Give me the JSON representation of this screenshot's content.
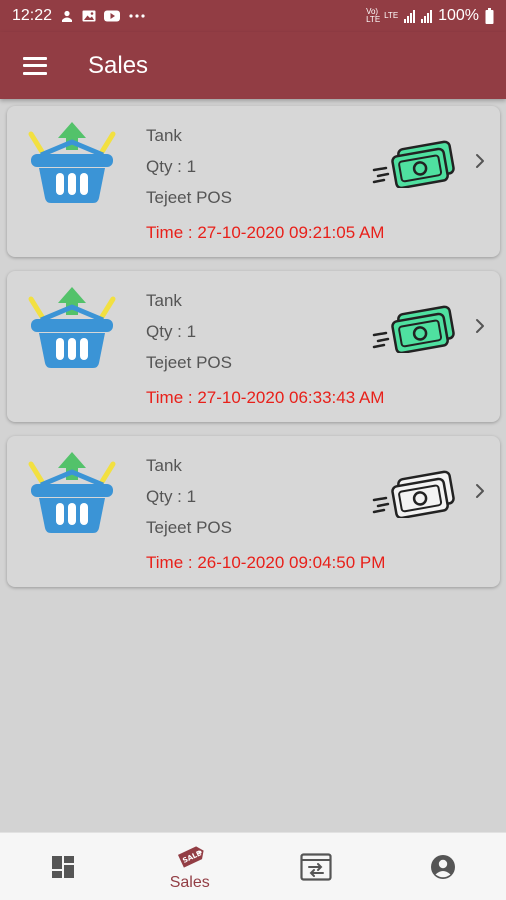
{
  "status_bar": {
    "time": "12:22",
    "battery": "100%",
    "icons": [
      "person-icon",
      "image-icon",
      "youtube-icon",
      "more-icon",
      "volte-icon",
      "lte-icon",
      "signal-icon",
      "battery-icon"
    ],
    "labels": {
      "volte": "Vo) LTE",
      "lte": "LTE"
    }
  },
  "app_bar": {
    "title": "Sales",
    "menu_icon": "hamburger-menu-icon"
  },
  "sales": [
    {
      "product": "Tank",
      "qty": "Qty : 1",
      "store": "Tejeet POS",
      "time": "Time : 27-10-2020 09:21:05 AM",
      "cash_color": "#4fe0a0",
      "paid": true
    },
    {
      "product": "Tank",
      "qty": "Qty : 1",
      "store": "Tejeet POS",
      "time": "Time : 27-10-2020 06:33:43 AM",
      "cash_color": "#4fe0a0",
      "paid": true
    },
    {
      "product": "Tank",
      "qty": "Qty : 1",
      "store": "Tejeet POS",
      "time": "Time : 26-10-2020 09:04:50 PM",
      "cash_color": "#f3f3f3",
      "paid": false
    }
  ],
  "bottom_nav": {
    "items": [
      {
        "icon": "dashboard-icon",
        "label": ""
      },
      {
        "icon": "sale-tag-icon",
        "label": "Sales",
        "active": true
      },
      {
        "icon": "transfer-icon",
        "label": ""
      },
      {
        "icon": "account-icon",
        "label": ""
      }
    ]
  },
  "colors": {
    "primary": "#923d44",
    "time_text": "#e8201a",
    "basket": "#3b94d6",
    "arrow": "#53c26a"
  }
}
